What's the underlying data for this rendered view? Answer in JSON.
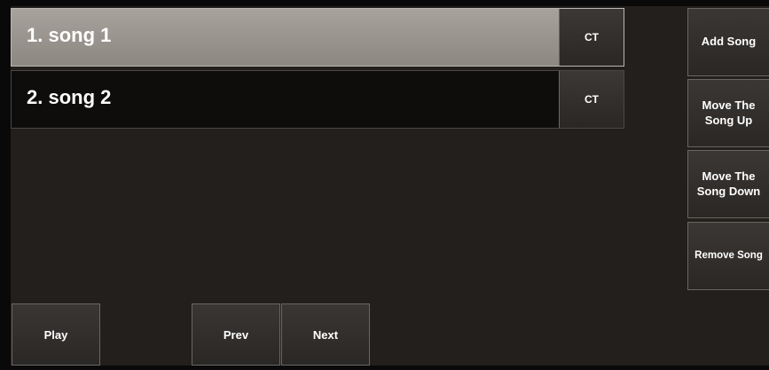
{
  "playlist": {
    "items": [
      {
        "label": "1. song 1",
        "action_label": "CT"
      },
      {
        "label": "2. song 2",
        "action_label": "CT"
      }
    ]
  },
  "side_controls": {
    "add_label": "Add Song",
    "move_up_label": "Move The Song Up",
    "move_down_label": "Move The Song Down",
    "remove_label": "Remove Song"
  },
  "transport": {
    "play_label": "Play",
    "prev_label": "Prev",
    "next_label": "Next"
  },
  "colors": {
    "background": "#221f1d",
    "selected_row": "#9a958f",
    "unselected_row": "#0f0d0c",
    "button": "#32302e",
    "text": "#ffffff"
  }
}
